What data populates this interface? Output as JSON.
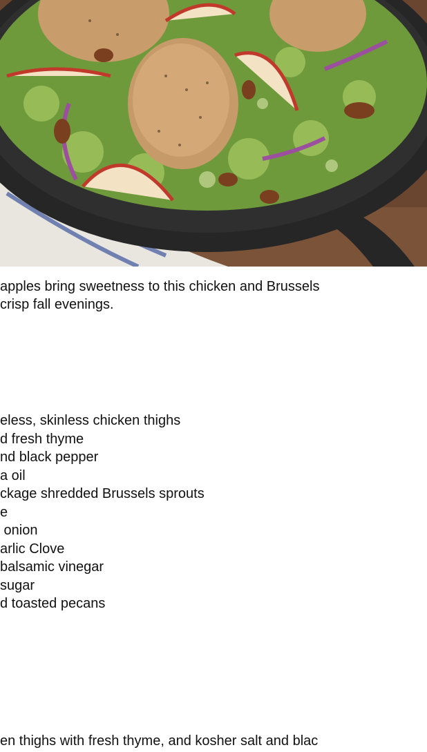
{
  "intro": {
    "lines": [
      "apples bring sweetness to this chicken and Brussels",
      "crisp fall evenings."
    ]
  },
  "ingredients": [
    "eless, skinless chicken thighs",
    "d fresh thyme",
    "nd black pepper",
    "a oil",
    "ckage shredded Brussels sprouts",
    "e",
    " onion",
    "arlic Clove",
    "balsamic vinegar",
    "sugar",
    "d toasted pecans"
  ],
  "directions": {
    "first_line": "en thighs with fresh thyme, and kosher salt and blac"
  }
}
